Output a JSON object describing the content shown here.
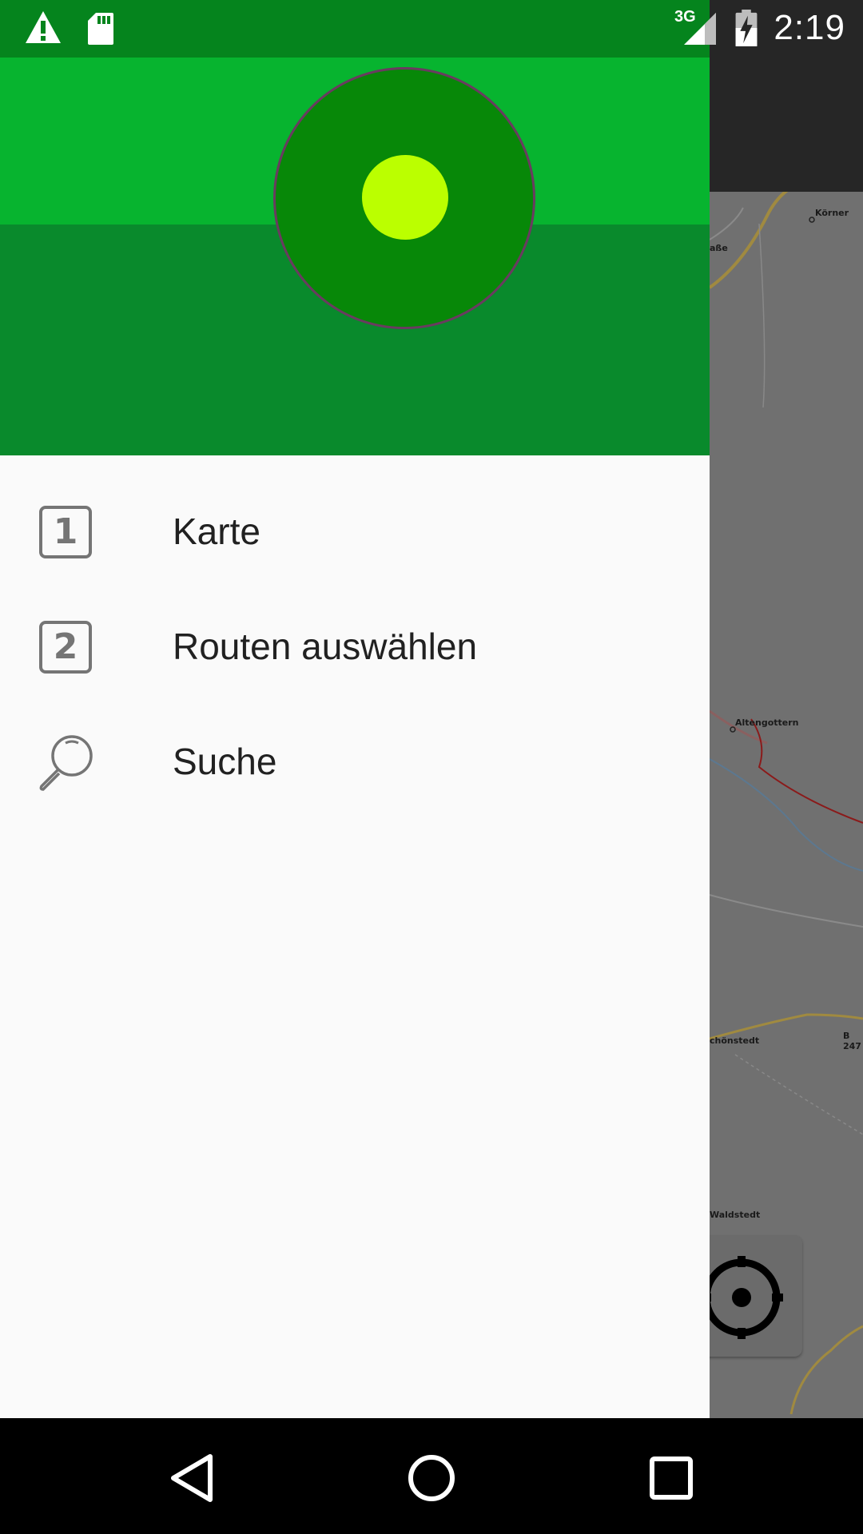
{
  "status_bar": {
    "network_type": "3G",
    "time": "2:19",
    "icons": [
      "warning-icon",
      "sd-card-icon",
      "signal-icon",
      "battery-charging-icon"
    ]
  },
  "map": {
    "labels": [
      "Körner",
      "Altengottern",
      "chönstedt",
      "B 247",
      "Waldstedt",
      "aße"
    ]
  },
  "drawer": {
    "items": [
      {
        "badge": "1",
        "label": "Karte",
        "icon": "number-1-icon"
      },
      {
        "badge": "2",
        "label": "Routen auswählen",
        "icon": "number-2-icon"
      },
      {
        "label": "Suche",
        "icon": "search-icon"
      }
    ]
  },
  "nav_bar": {
    "buttons": [
      "back-icon",
      "home-icon",
      "recents-icon"
    ]
  },
  "colors": {
    "header_light": "#07b42f",
    "header_dark": "#098a2c",
    "logo_circle": "#078808",
    "logo_dot": "#bbff00",
    "status_bar": "#05841d"
  }
}
